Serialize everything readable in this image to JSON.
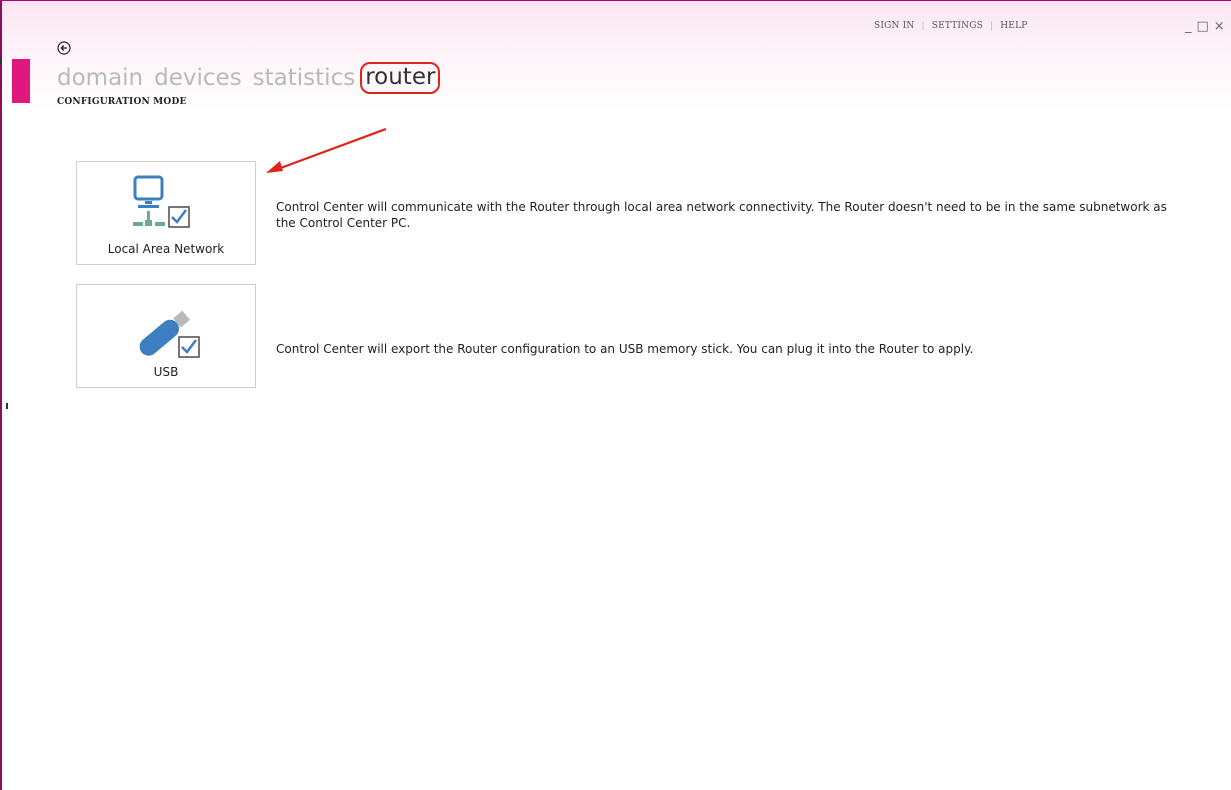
{
  "top_menu": {
    "sign_in": "SIGN IN",
    "settings": "SETTINGS",
    "help": "HELP"
  },
  "window_controls": {
    "minimize": "_",
    "maximize": "□",
    "close": "×"
  },
  "nav": {
    "items": [
      {
        "label": "domain"
      },
      {
        "label": "devices"
      },
      {
        "label": "statistics"
      },
      {
        "label": "router",
        "active": true
      }
    ]
  },
  "page": {
    "mode_title": "CONFIGURATION MODE"
  },
  "options": [
    {
      "label": "Local Area Network",
      "icon": "lan-computer-icon",
      "description": "Control Center will communicate with the Router through local area network connectivity. The Router doesn't need to be in the same subnetwork as the Control Center PC."
    },
    {
      "label": "USB",
      "icon": "usb-stick-icon",
      "description": "Control Center will export the Router configuration to an USB memory stick. You can plug it into the Router to apply."
    }
  ],
  "colors": {
    "accent": "#e0177d",
    "annotation": "#e0231a",
    "icon_blue": "#3d7fc1"
  }
}
